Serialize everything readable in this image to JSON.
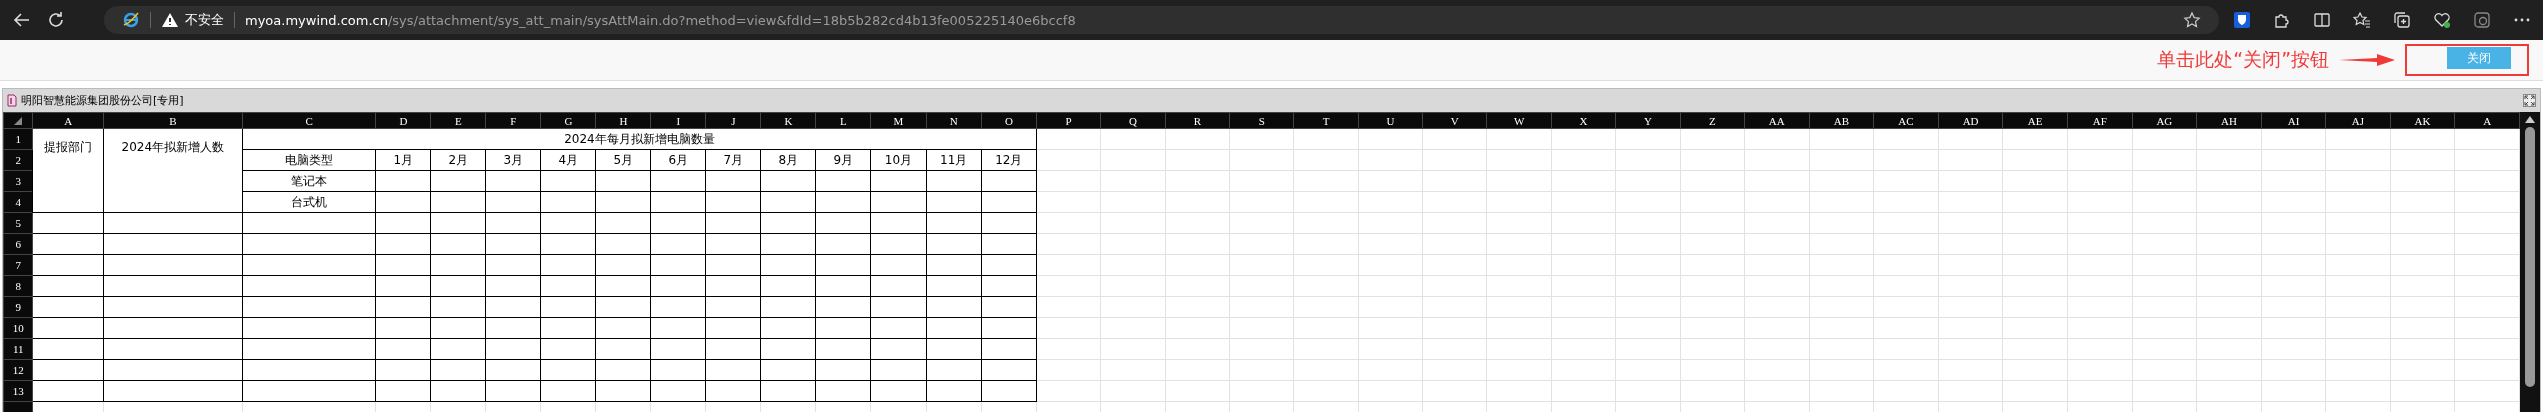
{
  "browser": {
    "address": {
      "security": "不安全",
      "host": "myoa.mywind.com.cn",
      "path": "/sys/attachment/sys_att_main/sysAttMain.do?method=view&fdId=18b5b282cd4b13fe005225140e6bccf8"
    }
  },
  "toolbar": {
    "annotation": "单击此处“关闭”按钮",
    "close_button": "关闭"
  },
  "sheet": {
    "title": "明阳智慧能源集团股份公司[专用]",
    "columns": [
      "A",
      "B",
      "C",
      "D",
      "E",
      "F",
      "G",
      "H",
      "I",
      "J",
      "K",
      "L",
      "M",
      "N",
      "O",
      "P",
      "Q",
      "R",
      "S",
      "T",
      "U",
      "V",
      "W",
      "X",
      "Y",
      "Z",
      "AA",
      "AB",
      "AC",
      "AD",
      "AE",
      "AF",
      "AG",
      "AH",
      "AI",
      "AJ",
      "AK",
      "A"
    ],
    "row_numbers": [
      "1",
      "2",
      "3",
      "4",
      "5",
      "6",
      "7",
      "8",
      "9",
      "10",
      "11",
      "12",
      "13"
    ],
    "table": {
      "dept_header": "提报部门",
      "headcount_header": "2024年拟新增人数",
      "title": "2024年每月拟新增电脑数量",
      "type_header": "电脑类型",
      "months": [
        "1月",
        "2月",
        "3月",
        "4月",
        "5月",
        "6月",
        "7月",
        "8月",
        "9月",
        "10月",
        "11月",
        "12月"
      ],
      "types": [
        "笔记本",
        "台式机"
      ]
    }
  }
}
